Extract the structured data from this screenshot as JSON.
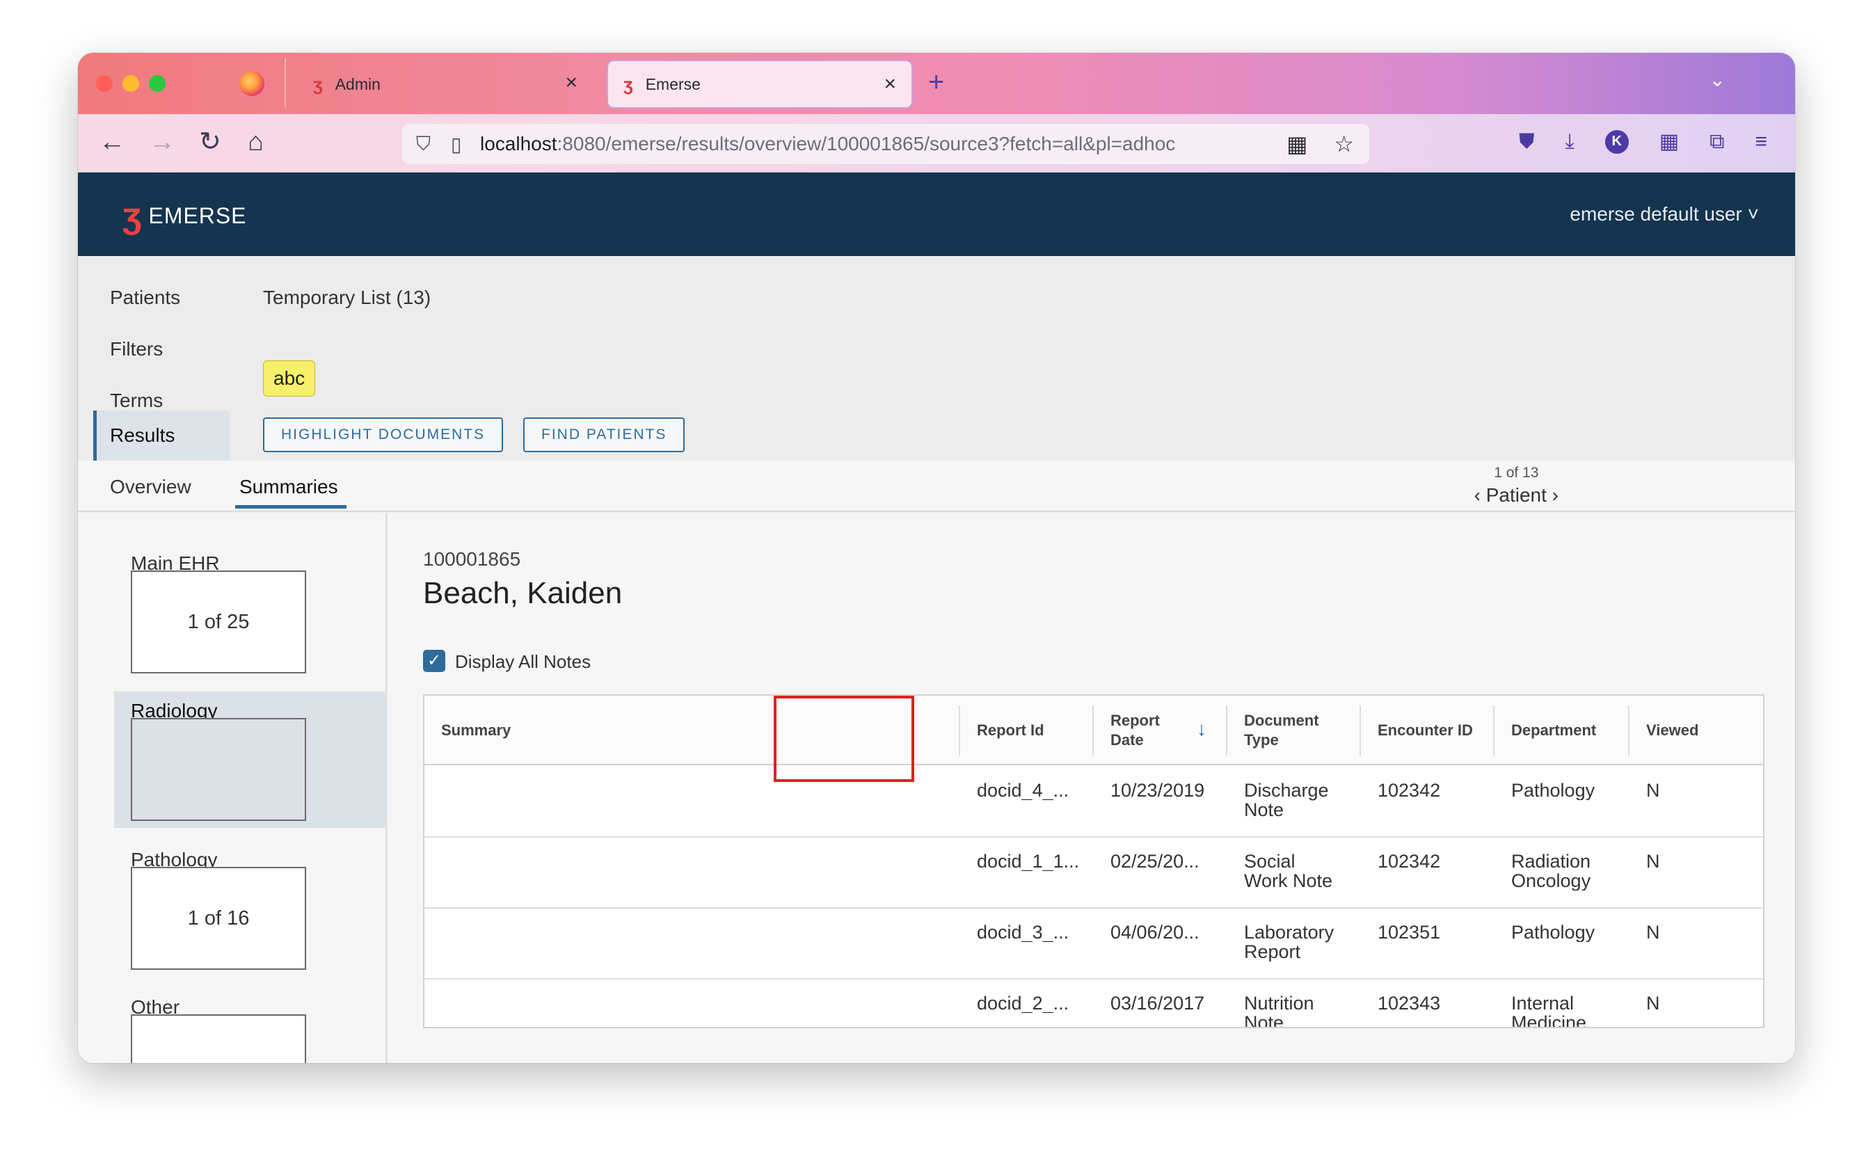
{
  "browser": {
    "tabs": [
      {
        "label": "Admin"
      },
      {
        "label": "Emerse"
      }
    ],
    "url": {
      "host": "localhost",
      "path": ":8080/emerse/results/overview/100001865/source3?fetch=all&pl=adhoc"
    },
    "avatar_initial": "K"
  },
  "app": {
    "brand": "EMERSE",
    "user_menu": "emerse default user ˅"
  },
  "query": {
    "patients_label": "Patients",
    "patients_value": "Temporary List (13)",
    "filters_label": "Filters",
    "terms_label": "Terms",
    "term_chip": "abc",
    "results_label": "Results",
    "highlight_button": "HIGHLIGHT DOCUMENTS",
    "find_button": "FIND PATIENTS"
  },
  "subtabs": {
    "overview": "Overview",
    "summaries": "Summaries",
    "pager_count": "1 of 13",
    "pager_label": "Patient"
  },
  "sources": [
    {
      "name": "Main EHR",
      "count": "1 of 25"
    },
    {
      "name": "Radiology",
      "count": ""
    },
    {
      "name": "Pathology",
      "count": "1 of 16"
    },
    {
      "name": "Other",
      "count": ""
    }
  ],
  "patient": {
    "id": "100001865",
    "name": "Beach, Kaiden",
    "display_all_notes": "Display All Notes"
  },
  "table": {
    "headers": {
      "summary": "Summary",
      "report_id": "Report Id",
      "report_date_1": "Report",
      "report_date_2": "Date",
      "doc_type_1": "Document",
      "doc_type_2": "Type",
      "encounter": "Encounter ID",
      "department": "Department",
      "viewed": "Viewed"
    },
    "rows": [
      {
        "summary": "",
        "report_id": "docid_4_...",
        "date": "10/23/2019",
        "type1": "Discharge",
        "type2": "Note",
        "encounter": "102342",
        "dept1": "Pathology",
        "dept2": "",
        "viewed": "N"
      },
      {
        "summary": "",
        "report_id": "docid_1_1...",
        "date": "02/25/20...",
        "type1": "Social",
        "type2": "Work Note",
        "encounter": "102342",
        "dept1": "Radiation",
        "dept2": "Oncology",
        "viewed": "N"
      },
      {
        "summary": "",
        "report_id": "docid_3_...",
        "date": "04/06/20...",
        "type1": "Laboratory",
        "type2": "Report",
        "encounter": "102351",
        "dept1": "Pathology",
        "dept2": "",
        "viewed": "N"
      },
      {
        "summary": "",
        "report_id": "docid_2_...",
        "date": "03/16/2017",
        "type1": "Nutrition",
        "type2": "Note",
        "encounter": "102343",
        "dept1": "Internal",
        "dept2": "Medicine",
        "viewed": "N"
      }
    ]
  },
  "colors": {
    "header_bg": "#14344f",
    "accent": "#2f6c9b",
    "brand_red": "#e8423f",
    "term_highlight": "#f7f06a",
    "annotation_red": "#e02020"
  }
}
